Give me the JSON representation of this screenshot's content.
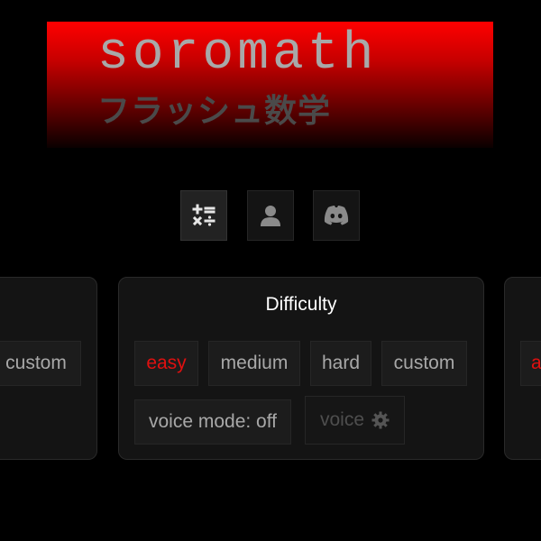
{
  "header": {
    "title": "soromath",
    "subtitle": "フラッシュ数学"
  },
  "toolbar": {
    "buttons": [
      {
        "name": "math-mode",
        "icon": "plus-minus-times-divide-icon",
        "active": true
      },
      {
        "name": "profile",
        "icon": "user-icon",
        "active": false
      },
      {
        "name": "discord",
        "icon": "discord-icon",
        "active": false
      }
    ]
  },
  "left_card": {
    "options": [
      "custom"
    ]
  },
  "difficulty_card": {
    "title": "Difficulty",
    "options": [
      "easy",
      "medium",
      "hard",
      "custom"
    ],
    "selected": "easy",
    "voice_mode_label": "voice mode: off",
    "voice_label": "voice"
  },
  "right_card": {
    "visible_letter": "a"
  },
  "colors": {
    "accent": "#e01010",
    "banner_top": "#ff0000",
    "background": "#000000",
    "card": "#141414"
  }
}
